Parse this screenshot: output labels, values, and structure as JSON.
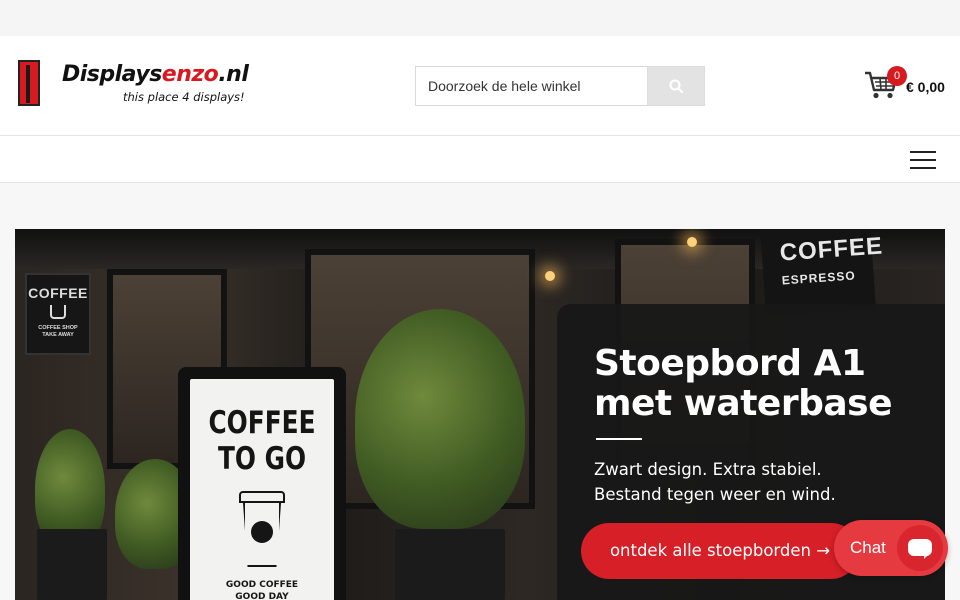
{
  "logo": {
    "name_part1": "Displays",
    "name_part2": "enzo",
    "name_part3": ".nl",
    "tagline": "this place 4 displays!"
  },
  "search": {
    "placeholder": "Doorzoek de hele winkel",
    "value": "",
    "button_icon": "search-icon"
  },
  "cart": {
    "count": "0",
    "total": "€ 0,00",
    "icon": "shopping-cart-icon"
  },
  "nav": {
    "menu_icon": "hamburger-menu-icon"
  },
  "hero": {
    "sign_small": {
      "line1": "COFFEE",
      "line2": "COFFEE SHOP\nTAKE AWAY"
    },
    "sign_top": {
      "line1": "COFFEE",
      "line2": "ESPRESSO"
    },
    "board": {
      "line1": "COFFEE",
      "line2": "TO GO",
      "footer": "GOOD COFFEE\nGOOD DAY"
    },
    "promo": {
      "title": "Stoepbord A1 met waterbase",
      "subtitle_line1": "Zwart design. Extra stabiel.",
      "subtitle_line2": "Bestand tegen weer en wind.",
      "cta_label": "ontdek alle stoepborden →"
    }
  },
  "chat": {
    "label": "Chat",
    "icon": "chat-bubble-icon"
  },
  "colors": {
    "brand_red": "#d71920",
    "cta_red": "#d61f26",
    "chat_red": "#e63a41",
    "promo_bg": "#181818"
  }
}
